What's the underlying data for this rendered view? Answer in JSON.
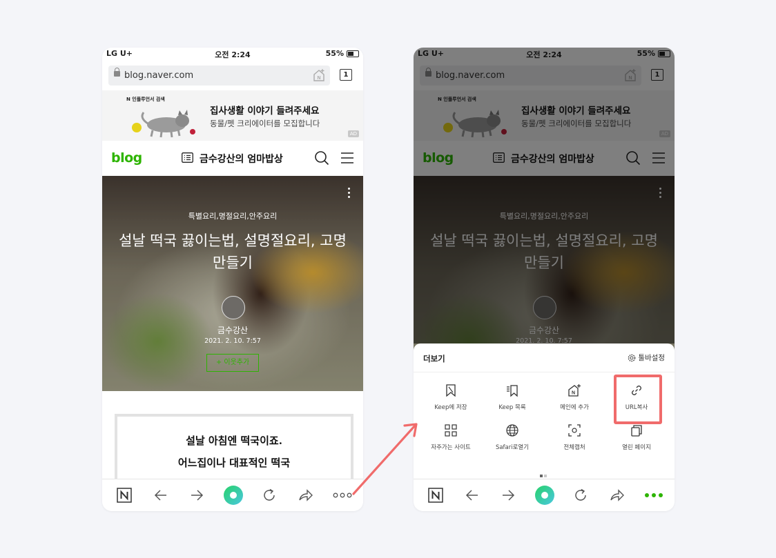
{
  "status": {
    "carrier": "LG U+",
    "time": "오전 2:24",
    "battery": "55%"
  },
  "browser": {
    "url": "blog.naver.com",
    "tab_count": "1"
  },
  "ad": {
    "brand": "N 인플루언서 검색",
    "headline": "집사생활 이야기 들려주세요",
    "subline": "동물/펫 크리에이터를 모집합니다",
    "badge": "AD"
  },
  "blog": {
    "logo": "blog",
    "title": "금수강산의 엄마밥상"
  },
  "post": {
    "category": "특별요리,명절요리,안주요리",
    "title": "설날 떡국 끓이는법, 설명절요리, 고명 만들기",
    "author": "금수강산",
    "date": "2021. 2. 10. 7:57",
    "neighbor_button": "+ 이웃추가",
    "body_line1": "설날 아침엔 떡국이죠.",
    "body_line2": "어느집이나 대표적인 떡국"
  },
  "more_sheet": {
    "title": "더보기",
    "settings": "툴바설정",
    "items": [
      {
        "label": "Keep에 저장",
        "icon": "bookmark-icon"
      },
      {
        "label": "Keep 목록",
        "icon": "keep-list-icon"
      },
      {
        "label": "메인에 추가",
        "icon": "home-add-icon"
      },
      {
        "label": "URL복사",
        "icon": "link-icon"
      },
      {
        "label": "자주가는 사이트",
        "icon": "grid-icon"
      },
      {
        "label": "Safari로열기",
        "icon": "globe-icon"
      },
      {
        "label": "전체캡처",
        "icon": "capture-icon"
      },
      {
        "label": "열린 페이지",
        "icon": "pages-icon"
      }
    ],
    "pager": {
      "pages": 2,
      "current": 1
    }
  },
  "colors": {
    "naver_green": "#2db400",
    "highlight": "#f06b6b",
    "background": "#f4f5f9"
  }
}
